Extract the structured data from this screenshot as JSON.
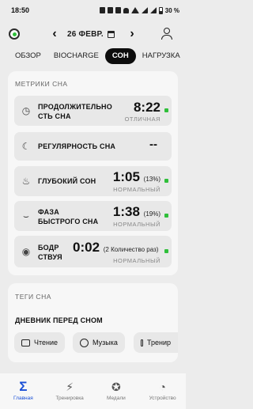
{
  "status_bar": {
    "time": "18:50",
    "battery": "30 %"
  },
  "header": {
    "date": "26 ФЕВР.",
    "prev_arrow": "‹",
    "next_arrow": "›"
  },
  "tabs": [
    {
      "label": "ОБЗОР",
      "active": false
    },
    {
      "label": "BIOCHARGE",
      "active": false
    },
    {
      "label": "СОН",
      "active": true
    },
    {
      "label": "НАГРУЗКА",
      "active": false
    }
  ],
  "metrics": {
    "title": "МЕТРИКИ СНА",
    "items": [
      {
        "label_line1": "ПРОДОЛЖИТЕЛЬНО",
        "label_line2": "СТЬ СНА",
        "value": "8:22",
        "pct": "",
        "status": "ОТЛИЧНАЯ",
        "icon": "clock-z-icon"
      },
      {
        "label_line1": "РЕГУЛЯРНОСТЬ СНА",
        "label_line2": "",
        "value": "--",
        "pct": "",
        "status": "",
        "icon": "moon-stars-icon"
      },
      {
        "label_line1": "ГЛУБОКИЙ СОН",
        "label_line2": "",
        "value": "1:05",
        "pct": "(13%)",
        "status": "НОРМАЛЬНЫЙ",
        "icon": "deep-sleep-icon"
      },
      {
        "label_line1": "ФАЗА",
        "label_line2": "БЫСТРОГО СНА",
        "value": "1:38",
        "pct": "(19%)",
        "status": "НОРМАЛЬНЫЙ",
        "icon": "closed-eye-icon"
      },
      {
        "label_line1": "БОДР",
        "label_line2": "СТВУЯ",
        "value": "0:02",
        "pct": "(2 Количество раз)",
        "status": "НОРМАЛЬНЫЙ",
        "icon": "open-eye-icon"
      }
    ]
  },
  "tags": {
    "title": "ТЕГИ СНА",
    "diary_title": "ДНЕВНИК ПЕРЕД СНОМ",
    "chips": [
      {
        "label": "Чтение",
        "icon": "book-icon"
      },
      {
        "label": "Музыка",
        "icon": "headphones-icon"
      },
      {
        "label": "Тренир",
        "icon": "dumbbell-icon"
      }
    ]
  },
  "bottom_nav": [
    {
      "label": "Главная",
      "icon": "sigma-icon",
      "active": true
    },
    {
      "label": "Тренировка",
      "icon": "running-icon",
      "active": false
    },
    {
      "label": "Медали",
      "icon": "medal-icon",
      "active": false
    },
    {
      "label": "Устройство",
      "icon": "watch-icon",
      "active": false
    }
  ],
  "colors": {
    "accent_green": "#2fbf3a",
    "accent_blue": "#1a4fd6",
    "active_tab_bg": "#0c0c0c"
  }
}
